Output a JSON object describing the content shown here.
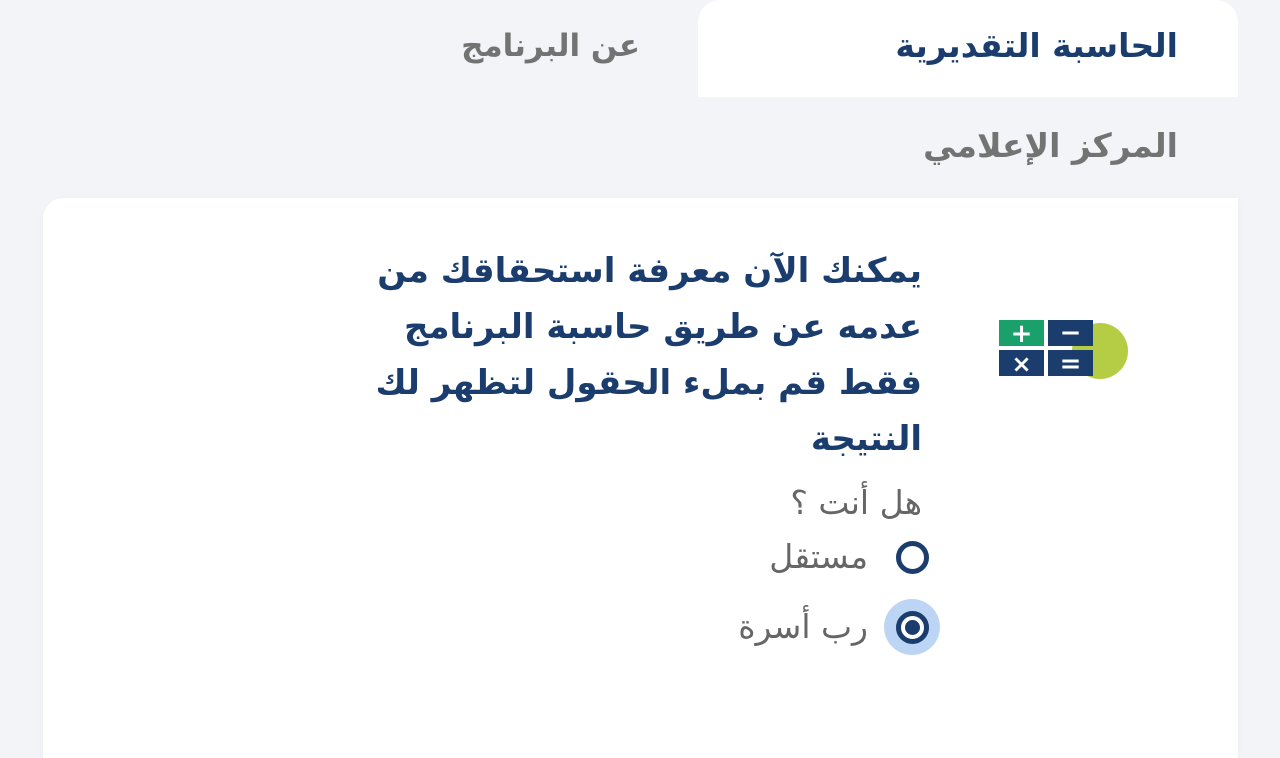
{
  "tabs": {
    "estimator": "الحاسبة التقديرية",
    "about": "عن البرنامج",
    "media_center": "المركز الإعلامي"
  },
  "card": {
    "intro_lines": [
      "يمكنك الآن معرفة استحقاقك من",
      "عدمه عن طريق حاسبة البرنامج",
      "فقط قم بملء الحقول لتظهر لك",
      "النتيجة"
    ],
    "question": "هل أنت ؟",
    "options": [
      {
        "label": "مستقل",
        "selected": false
      },
      {
        "label": "رب أسرة",
        "selected": true
      }
    ],
    "logo_icon": "calculator-icon",
    "logo_symbols": [
      "+",
      "−",
      "×",
      "="
    ]
  },
  "colors": {
    "primary": "#1a3d6e",
    "muted_text": "#666666",
    "tab_inactive": "#737373",
    "background": "#f3f4f8",
    "card": "#ffffff",
    "radio_highlight": "#bdd5f5",
    "logo_green_circle": "#b5cc45",
    "logo_plus_tile": "#1aa06a",
    "logo_navy_tile": "#1a3d6e"
  }
}
